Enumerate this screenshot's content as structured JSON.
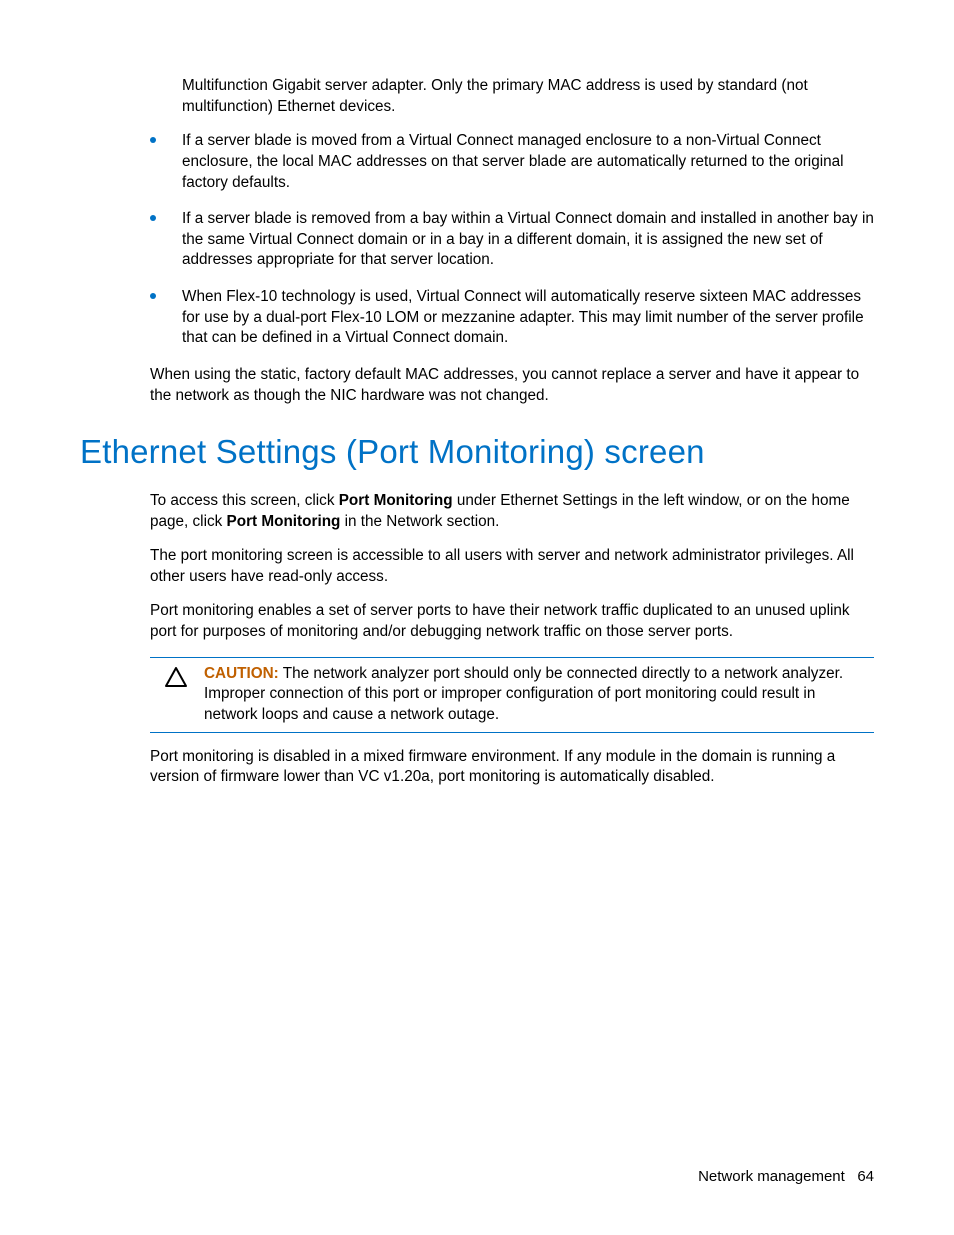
{
  "continuation_para": "Multifunction Gigabit server adapter. Only the primary MAC address is used by standard (not multifunction) Ethernet devices.",
  "bullets": [
    "If a server blade is moved from a Virtual Connect managed enclosure to a non-Virtual Connect enclosure, the local MAC addresses on that server blade are automatically returned to the original factory defaults.",
    "If a server blade is removed from a bay within a Virtual Connect domain and installed in another bay in the same Virtual Connect domain or in a bay in a different domain, it is assigned the new set of addresses appropriate for that server location.",
    "When Flex-10 technology is used, Virtual Connect will automatically reserve sixteen MAC addresses for use by a dual-port Flex-10 LOM or mezzanine adapter. This may limit number of the server profile that can be defined in a Virtual Connect domain."
  ],
  "post_bullets_para": "When using the static, factory default MAC addresses, you cannot replace a server and have it appear to the network as though the NIC hardware was not changed.",
  "heading": "Ethernet Settings (Port Monitoring) screen",
  "access_para": {
    "pre1": "To access this screen, click ",
    "bold1": "Port Monitoring",
    "mid1": " under Ethernet Settings in the left window, or on the home page, click ",
    "bold2": "Port Monitoring",
    "post1": " in the Network section."
  },
  "privileges_para": "The port monitoring screen is accessible to all users with server and network administrator privileges. All other users have read-only access.",
  "enable_para": "Port monitoring enables a set of server ports to have their network traffic duplicated to an unused uplink port for purposes of monitoring and/or debugging network traffic on those server ports.",
  "caution": {
    "label": "CAUTION:",
    "text": "  The network analyzer port should only be connected directly to a network analyzer. Improper connection of this port or improper configuration of port monitoring could result in network loops and cause a network outage."
  },
  "disabled_para": "Port monitoring is disabled in a mixed firmware environment. If any module in the domain is running a version of firmware lower than VC v1.20a, port monitoring is automatically disabled.",
  "footer": {
    "section": "Network management",
    "page": "64"
  }
}
